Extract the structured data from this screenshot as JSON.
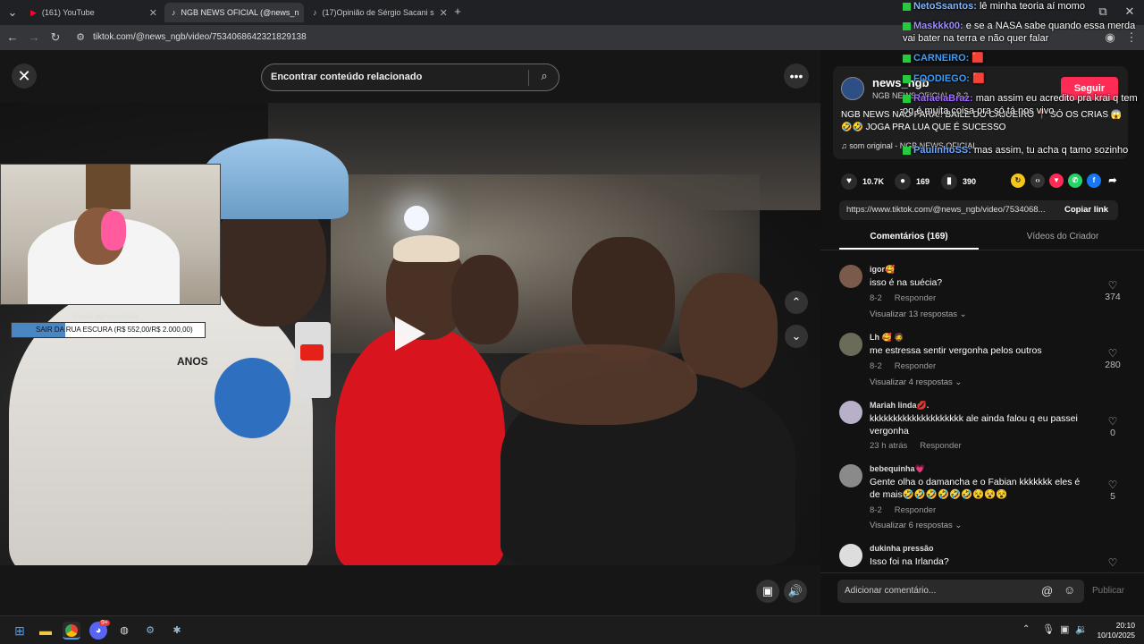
{
  "browser": {
    "tabs": [
      {
        "label": "(161) YouTube",
        "icon": "youtube-icon"
      },
      {
        "label": "NGB NEWS OFICIAL (@news_n",
        "icon": "tiktok-icon"
      },
      {
        "label": "(17)Opinião de Sérgio Sacani s",
        "icon": "tiktok-icon"
      }
    ],
    "url": "tiktok.com/@news_ngb/video/7534068642321829138"
  },
  "viewer": {
    "search_placeholder": "Encontrar conteúdo relacionado",
    "overlay_url": "livepix.gg/moraismia",
    "goal_text": "SAIR DA RUA ESCURA (R$ 552,00/R$ 2.000,00)",
    "goal_progress": 0.276,
    "mic_text": "ANOS"
  },
  "post": {
    "username": "news_ngb",
    "nickname": "NGB NEWS OFICIAL · 8-2",
    "follow_label": "Seguir",
    "caption": "NGB NEWS NÃO PARA!! BAILE DO CAJUEIRO 📍 SÓ OS CRIAS 😱🤣🤣 JOGA PRA LUA QUE É SUCESSO",
    "sound": "♫  som original - NGB NEWS OFICIAL",
    "likes": "10.7K",
    "comments": "169",
    "saves": "390",
    "link": "https://www.tiktok.com/@news_ngb/video/7534068...",
    "copy_label": "Copiar link"
  },
  "panel_tabs": [
    "Comentários (169)",
    "Vídeos do Criador"
  ],
  "comments": [
    {
      "user": "igor🥰",
      "text": "isso é na suécia?",
      "date": "8-2",
      "reply": "Responder",
      "replies": "Visualizar 13 respostas ⌄",
      "likes": "374"
    },
    {
      "user": "Lh 🥰 🧔",
      "text": "me estressa sentir vergonha pelos outros",
      "date": "8-2",
      "reply": "Responder",
      "replies": "Visualizar 4 respostas ⌄",
      "likes": "280"
    },
    {
      "user": "Mariah linda💋.",
      "text": "kkkkkkkkkkkkkkkkkkkk ale ainda falou q eu passei vergonha",
      "date": "23 h atrás",
      "reply": "Responder",
      "replies": "",
      "likes": "0"
    },
    {
      "user": "bebequinha💗",
      "text": "Gente olha o damancha e o Fabian kkkkkkk eles é de mais🤣🤣🤣🤣🤣🤣😵😵😵",
      "date": "8-2",
      "reply": "Responder",
      "replies": "Visualizar 6 respostas ⌄",
      "likes": "5"
    },
    {
      "user": "dukinha pressão",
      "text": "Isso foi na Irlanda?",
      "date": "",
      "reply": "",
      "replies": "",
      "likes": ""
    }
  ],
  "compose": {
    "placeholder": "Adicionar comentário...",
    "publish": "Publicar"
  },
  "chat": [
    {
      "name": "NetoSsantos:",
      "msg": " lê minha teoria aí momo"
    },
    {
      "name": "Maskkk00:",
      "msg": " e se a NASA sabe quando essa merda vai bater na terra e não quer falar"
    },
    {
      "name": "CARNEIRO:",
      "msg": " 🟥"
    },
    {
      "name": "FOODIEGO:",
      "msg": " 🟥"
    },
    {
      "name": "RafaelaBraz:",
      "msg": " man assim eu acredito pra krai q tem og é muita coisa pra só tá nos vivo"
    },
    {
      "name": "PaulinhoSS:",
      "msg": " mas assim, tu acha q tamo sozinho"
    }
  ],
  "taskbar": {
    "time": "20:10",
    "date": "10/10/2025",
    "notif": "9+"
  }
}
